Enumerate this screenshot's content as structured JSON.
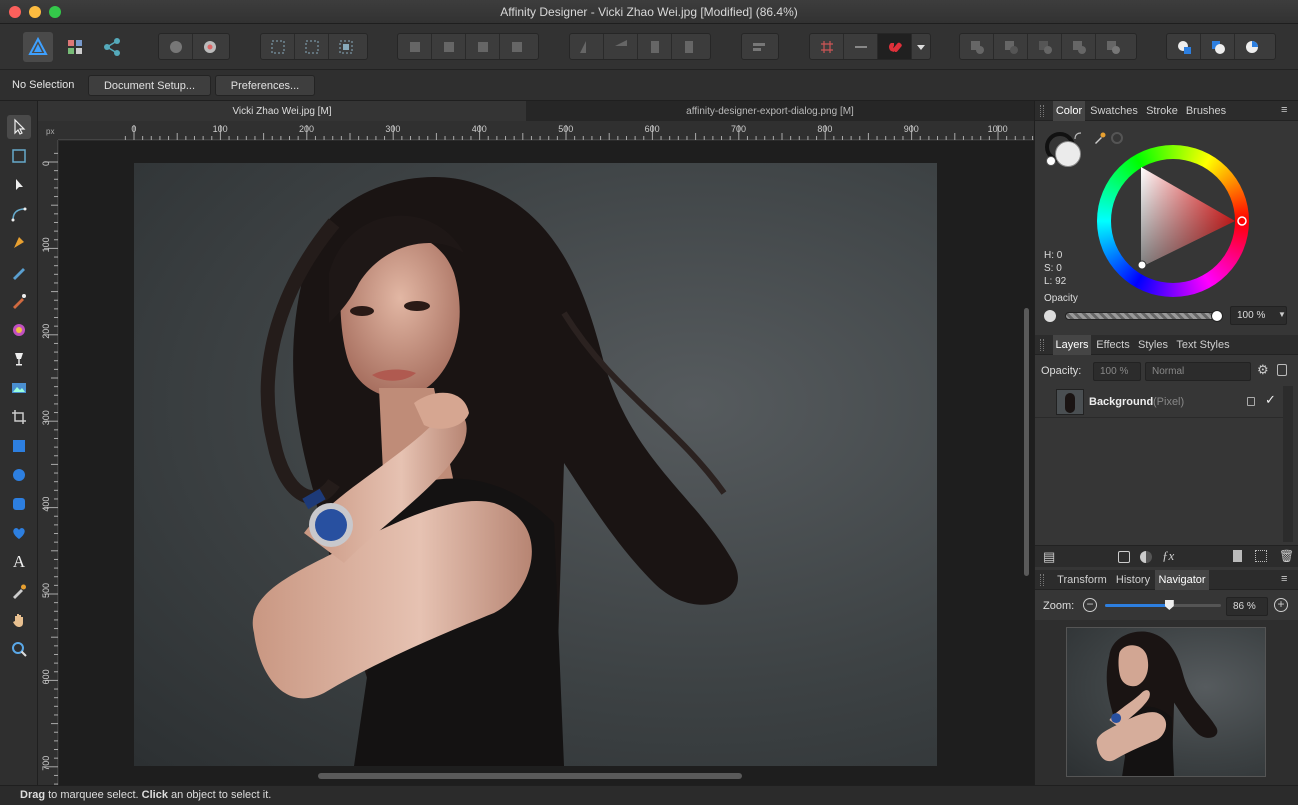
{
  "window": {
    "title": "Affinity Designer - Vicki Zhao Wei.jpg [Modified] (86.4%)"
  },
  "context": {
    "selection": "No Selection",
    "doc_setup": "Document Setup...",
    "preferences": "Preferences..."
  },
  "doc_tabs": [
    {
      "label": "Vicki Zhao Wei.jpg [M]"
    },
    {
      "label": "affinity-designer-export-dialog.png [M]"
    }
  ],
  "ruler": {
    "unit": "px",
    "h_labels": [
      "0",
      "100",
      "200",
      "300",
      "400",
      "500",
      "600",
      "700",
      "800",
      "900",
      "1000"
    ],
    "v_labels": [
      "0",
      "100",
      "200",
      "300",
      "400",
      "500",
      "600",
      "700"
    ]
  },
  "color_panel": {
    "tabs": [
      "Color",
      "Swatches",
      "Stroke",
      "Brushes"
    ],
    "h": "H: 0",
    "s": "S: 0",
    "l": "L: 92",
    "opacity_label": "Opacity",
    "opacity_value": "100 %"
  },
  "layers_panel": {
    "tabs": [
      "Layers",
      "Effects",
      "Styles",
      "Text Styles"
    ],
    "opacity_label": "Opacity:",
    "opacity_value": "100 %",
    "blend_mode": "Normal",
    "layer_name": "Background",
    "layer_type": "(Pixel)"
  },
  "navigator_panel": {
    "tabs": [
      "Transform",
      "History",
      "Navigator"
    ],
    "zoom_label": "Zoom:",
    "zoom_value": "86 %",
    "zoom_fraction": 0.55
  },
  "status": {
    "drag": "Drag",
    "text1": " to marquee select. ",
    "click": "Click",
    "text2": " an object to select it."
  },
  "colors": {
    "accent": "#2d7fe0",
    "snap_red": "#e0303a"
  }
}
